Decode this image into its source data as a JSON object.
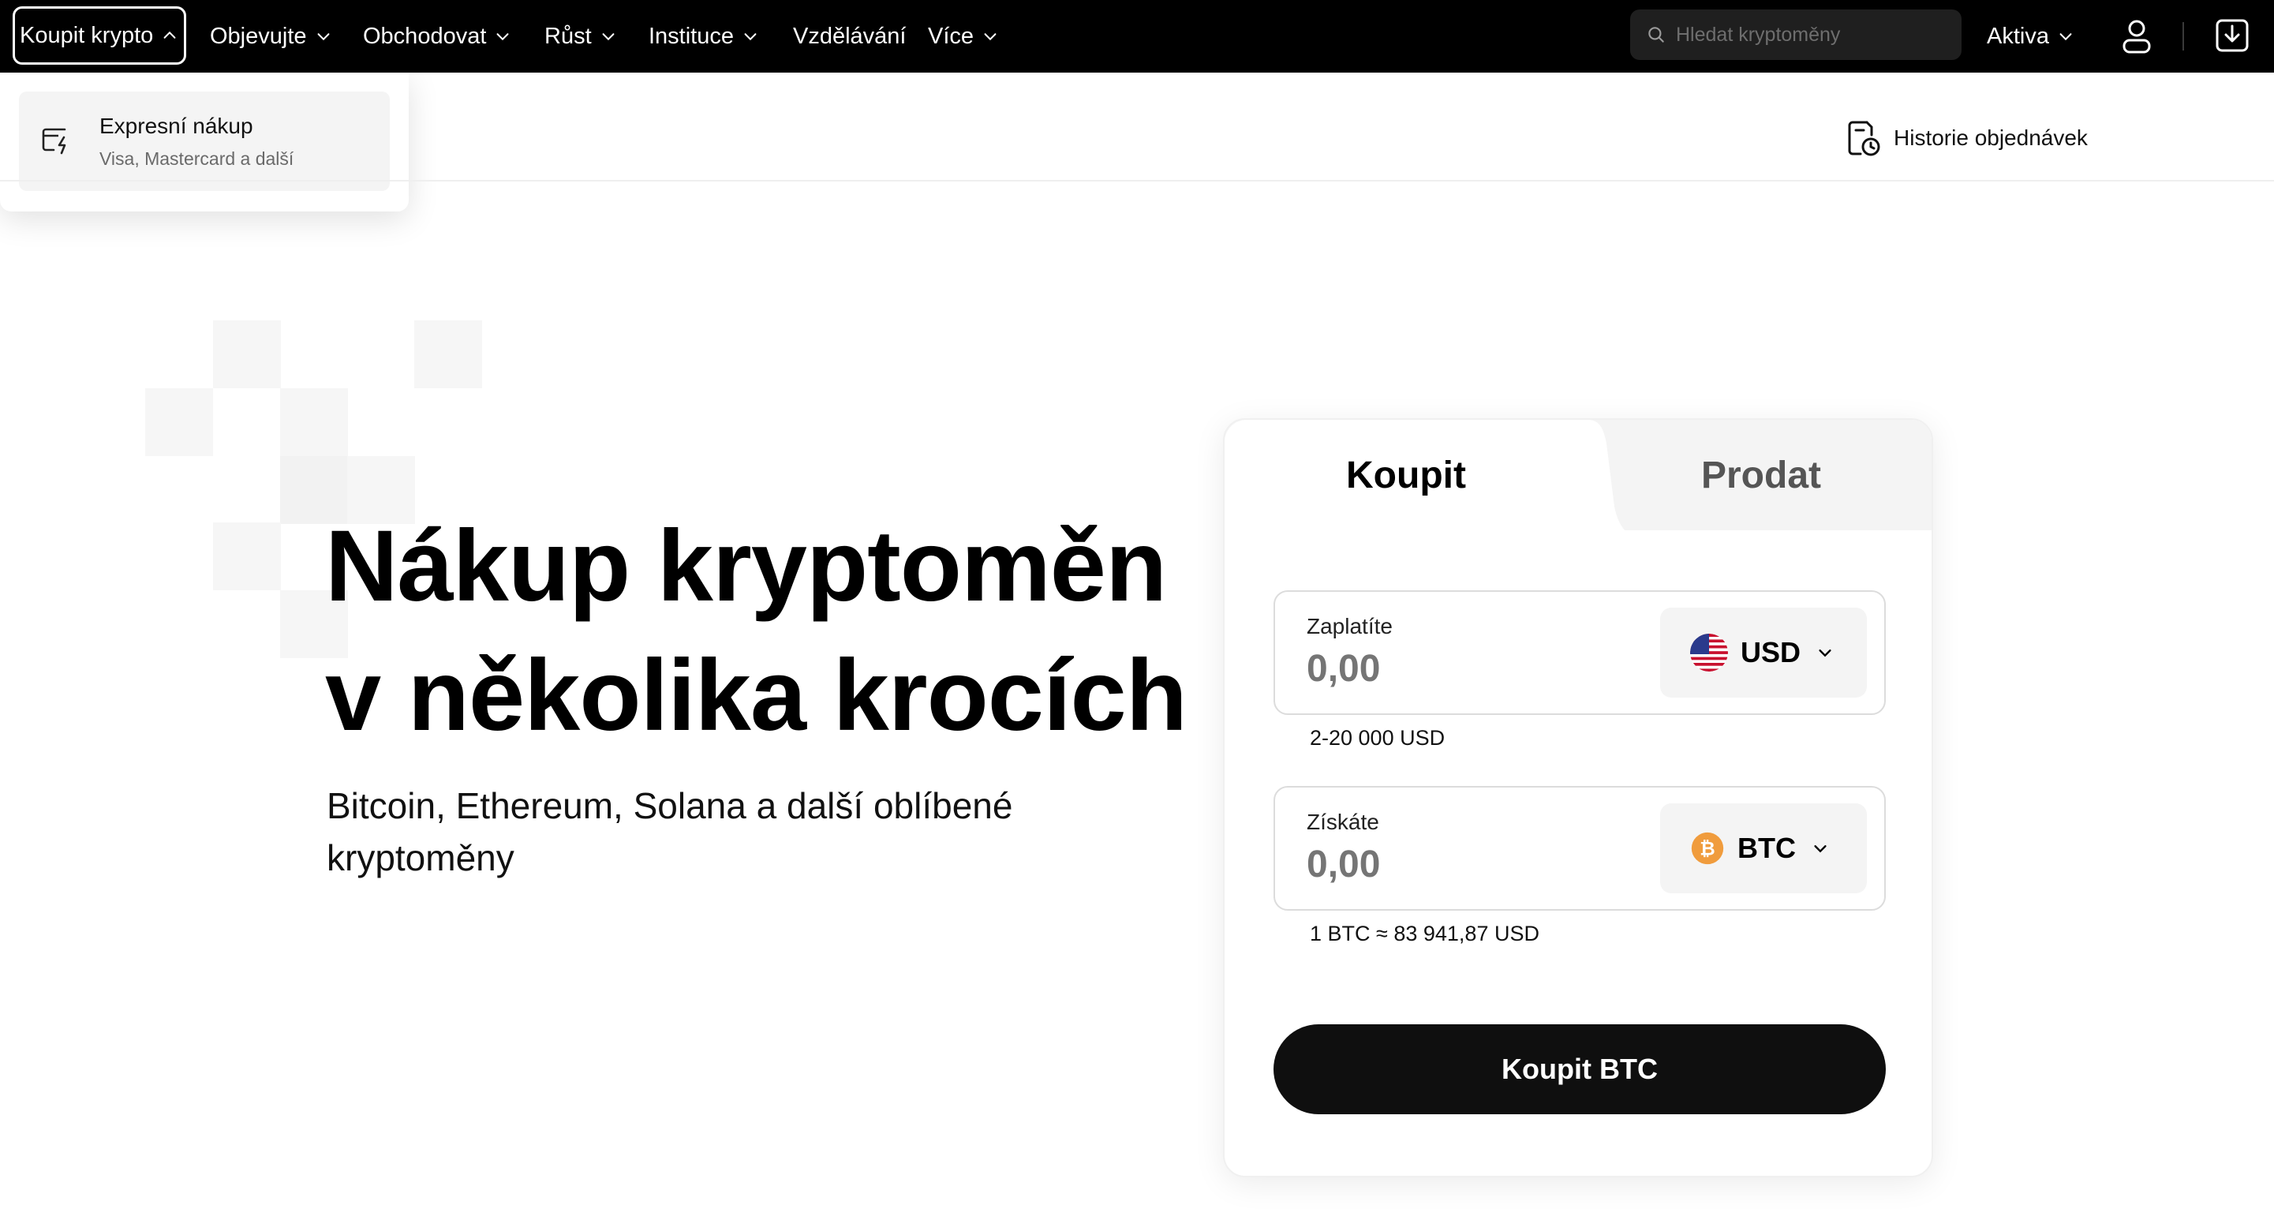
{
  "nav": {
    "active_item": "Koupit krypto",
    "items": [
      "Objevujte",
      "Obchodovat",
      "Růst",
      "Instituce",
      "Vzdělávání",
      "Více"
    ],
    "search_placeholder": "Hledat kryptoměny",
    "assets_label": "Aktiva"
  },
  "dropdown": {
    "item_title": "Expresní nákup",
    "item_subtitle": "Visa, Mastercard a další"
  },
  "subheader": {
    "history_label": "Historie objednávek"
  },
  "hero": {
    "title_line1": "Nákup kryptoměn",
    "title_line2": "v několika krocích",
    "subtitle": "Bitcoin, Ethereum, Solana a další oblíbené kryptoměny"
  },
  "card": {
    "tab_buy": "Koupit",
    "tab_sell": "Prodat",
    "pay_label": "Zaplatíte",
    "pay_value": "0,00",
    "pay_currency": "USD",
    "pay_limit": "2-20 000 USD",
    "receive_label": "Získáte",
    "receive_value": "0,00",
    "receive_currency": "BTC",
    "rate": "1 BTC ≈ 83 941,87 USD",
    "buy_button": "Koupit BTC"
  },
  "colors": {
    "nav_bg": "#000000",
    "button_bg": "#0f0f0f",
    "btc_orange": "#f7931a"
  }
}
